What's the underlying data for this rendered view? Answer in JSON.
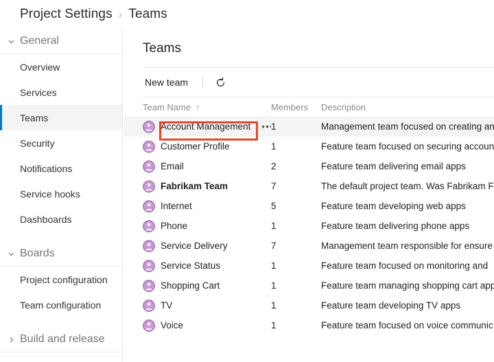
{
  "breadcrumb": {
    "items": [
      "Project Settings",
      "Teams"
    ],
    "separator": "›"
  },
  "sidebar": {
    "groups": [
      {
        "label": "General",
        "expanded": true,
        "chevron": "chevron-down-icon",
        "items": [
          {
            "label": "Overview",
            "selected": false
          },
          {
            "label": "Services",
            "selected": false
          },
          {
            "label": "Teams",
            "selected": true
          },
          {
            "label": "Security",
            "selected": false
          },
          {
            "label": "Notifications",
            "selected": false
          },
          {
            "label": "Service hooks",
            "selected": false
          },
          {
            "label": "Dashboards",
            "selected": false
          }
        ]
      },
      {
        "label": "Boards",
        "expanded": true,
        "chevron": "chevron-down-icon",
        "items": [
          {
            "label": "Project configuration",
            "selected": false
          },
          {
            "label": "Team configuration",
            "selected": false
          }
        ]
      },
      {
        "label": "Build and release",
        "expanded": false,
        "chevron": "chevron-right-icon",
        "items": []
      }
    ]
  },
  "main": {
    "title": "Teams",
    "toolbar": {
      "new_team_label": "New team",
      "refresh_icon": "refresh-icon"
    },
    "table": {
      "columns": [
        "Team Name",
        "Members",
        "Description"
      ],
      "sort_column": "Team Name",
      "sort_indicator": "↑",
      "rows": [
        {
          "name": "Account Management",
          "members": "1",
          "description": "Management team focused on creating an",
          "is_default": false,
          "hovered": true,
          "show_ellipsis": true,
          "annotated": true
        },
        {
          "name": "Customer Profile",
          "members": "1",
          "description": "Feature team focused on securing accoun",
          "is_default": false,
          "hovered": false,
          "show_ellipsis": false,
          "annotated": false
        },
        {
          "name": "Email",
          "members": "2",
          "description": "Feature team delivering email apps",
          "is_default": false,
          "hovered": false,
          "show_ellipsis": false,
          "annotated": false
        },
        {
          "name": "Fabrikam Team",
          "members": "7",
          "description": "The default project team. Was Fabrikam Fi",
          "is_default": true,
          "hovered": false,
          "show_ellipsis": false,
          "annotated": false
        },
        {
          "name": "Internet",
          "members": "5",
          "description": "Feature team developing web apps",
          "is_default": false,
          "hovered": false,
          "show_ellipsis": false,
          "annotated": false
        },
        {
          "name": "Phone",
          "members": "1",
          "description": "Feature team delivering phone apps",
          "is_default": false,
          "hovered": false,
          "show_ellipsis": false,
          "annotated": false
        },
        {
          "name": "Service Delivery",
          "members": "7",
          "description": "Management team responsible for ensure",
          "is_default": false,
          "hovered": false,
          "show_ellipsis": false,
          "annotated": false
        },
        {
          "name": "Service Status",
          "members": "1",
          "description": "Feature team focused on monitoring and ",
          "is_default": false,
          "hovered": false,
          "show_ellipsis": false,
          "annotated": false
        },
        {
          "name": "Shopping Cart",
          "members": "1",
          "description": "Feature team managing shopping cart app",
          "is_default": false,
          "hovered": false,
          "show_ellipsis": false,
          "annotated": false
        },
        {
          "name": "TV",
          "members": "1",
          "description": "Feature team developing TV apps",
          "is_default": false,
          "hovered": false,
          "show_ellipsis": false,
          "annotated": false
        },
        {
          "name": "Voice",
          "members": "1",
          "description": "Feature team focused on voice communic",
          "is_default": false,
          "hovered": false,
          "show_ellipsis": false,
          "annotated": false
        }
      ],
      "ellipsis_label": "•••",
      "row_icon": "team-avatar-icon"
    }
  },
  "colors": {
    "accent_blue": "#0078d4",
    "annotation_red": "#e8462a",
    "avatar_purple": "#b37cc4",
    "row_hover": "#f4f4f4"
  }
}
